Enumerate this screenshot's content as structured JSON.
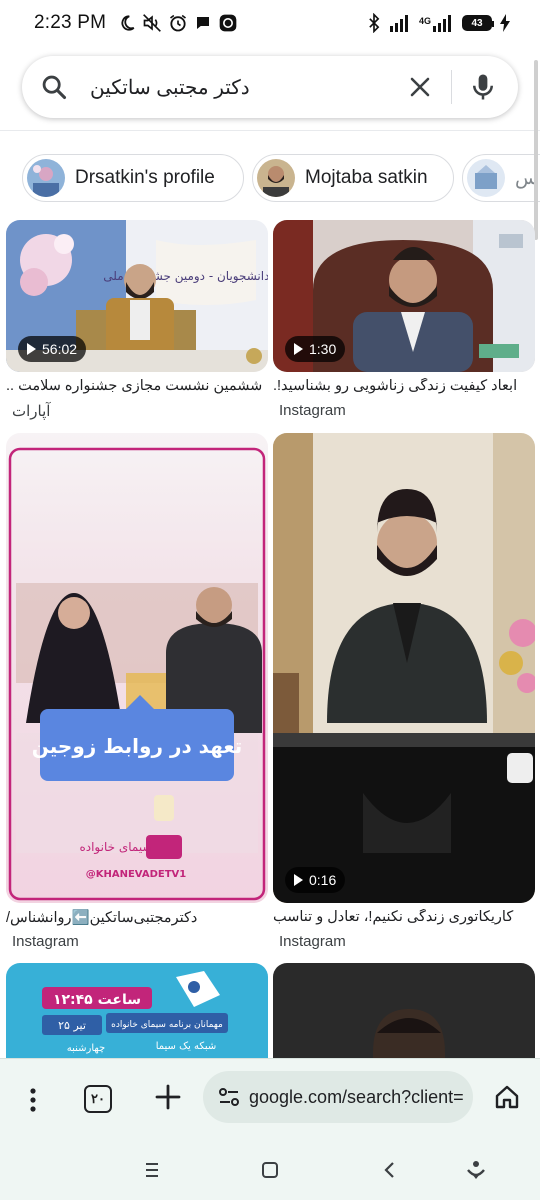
{
  "status_bar": {
    "time": "2:23 PM",
    "network_label": "4G",
    "battery_level": "43",
    "icons": [
      "moon-icon",
      "mute-icon",
      "alarm-icon",
      "chat-icon",
      "app-icon",
      "bluetooth-icon",
      "signal-icon",
      "signal-4g-icon",
      "battery-icon",
      "charging-icon"
    ]
  },
  "search": {
    "query": "دکتر مجتبی ساتکین"
  },
  "chips": [
    {
      "label": "Drsatkin's profile"
    },
    {
      "label": "Mojtaba satkin"
    },
    {
      "label": "س"
    }
  ],
  "results": [
    {
      "duration": "56:02",
      "title": "ششمین نشست مجازی جشنواره سلامت ..",
      "source": "آپارات",
      "banner_text": "سلامت دانشجویان - دومین جشنواره ملی"
    },
    {
      "duration": "1:30",
      "title": "ابعاد کیفیت زندگی زناشویی رو بشناسید!.",
      "source": "Instagram"
    },
    {
      "duration": "",
      "title": "دکترمجتبی‌ساتکین⬅️روانشناس/",
      "source": "Instagram",
      "banner_text": "تعهد در روابط زوجین",
      "logo_text": "سیمای خانواده",
      "handle": "@KHANEVADETV1"
    },
    {
      "duration": "0:16",
      "title": "کاریکاتوری زندگی نکنیم!، تعادل و تناسب",
      "source": "Instagram"
    },
    {
      "duration": "",
      "title": "",
      "source": "",
      "banner_time": "ساعت ۱۲:۴۵",
      "banner_line1": "مهمانان برنامه سیمای خانواده",
      "banner_date": "۲۵ تیر",
      "banner_channel": "شبکه یک سیما",
      "banner_day": "چهارشنبه"
    },
    {
      "duration": "",
      "title": "",
      "source": ""
    }
  ],
  "browser": {
    "tab_count": "۲۰",
    "url": "google.com/search?client="
  },
  "colors": {
    "bottom_bar_bg": "#eff6f3",
    "url_pill_bg": "#dfe9e5",
    "chip_border": "#dadce0"
  }
}
